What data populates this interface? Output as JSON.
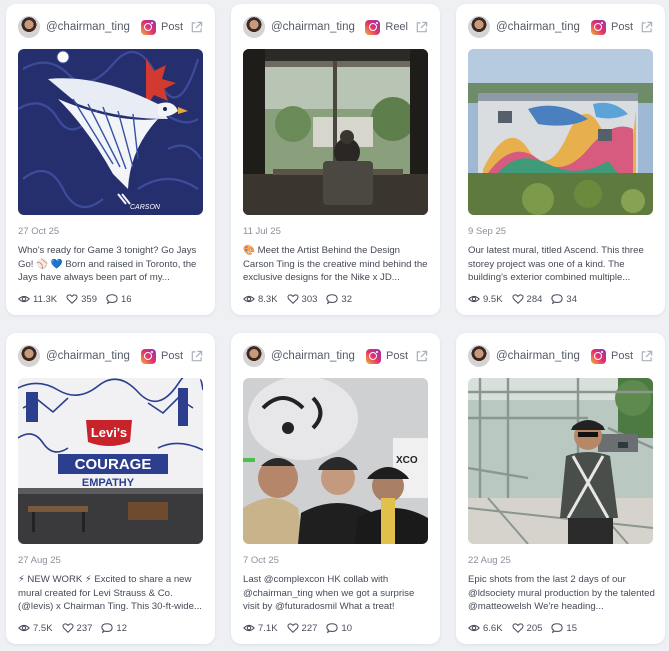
{
  "cards": [
    {
      "handle": "@chairman_ting",
      "post_type": "Post",
      "date": "27 Oct 25",
      "caption": "Who's ready for Game 3 tonight? Go Jays Go! ⚾ 💙 Born and raised in Toronto, the Jays have always been part of my...",
      "views": "11.3K",
      "likes": "359",
      "comments": "16"
    },
    {
      "handle": "@chairman_ting",
      "post_type": "Reel",
      "date": "11 Jul 25",
      "caption": "🎨 Meet the Artist Behind the Design Carson Ting is the creative mind behind the exclusive designs for the Nike x JD...",
      "views": "8.3K",
      "likes": "303",
      "comments": "32"
    },
    {
      "handle": "@chairman_ting",
      "post_type": "Post",
      "date": "9 Sep 25",
      "caption": "Our latest mural, titled Ascend. This three storey project was one of a kind. The building's exterior combined multiple...",
      "views": "9.5K",
      "likes": "284",
      "comments": "34"
    },
    {
      "handle": "@chairman_ting",
      "post_type": "Post",
      "date": "27 Aug 25",
      "caption": "⚡ NEW WORK ⚡ Excited to share a new mural created for Levi Strauss & Co. (@levis) x Chairman Ting. This 30-ft-wide...",
      "views": "7.5K",
      "likes": "237",
      "comments": "12"
    },
    {
      "handle": "@chairman_ting",
      "post_type": "Post",
      "date": "7 Oct 25",
      "caption": "Last @complexcon HK collab with @chairman_ting when we got a surprise visit by @futuradosmil What a treat!",
      "views": "7.1K",
      "likes": "227",
      "comments": "10"
    },
    {
      "handle": "@chairman_ting",
      "post_type": "Post",
      "date": "22 Aug 25",
      "caption": "Epic shots from the last 2 days of our @ldsociety mural production by the talented @matteowelsh We're heading...",
      "views": "6.6K",
      "likes": "205",
      "comments": "15"
    }
  ],
  "images": {
    "levis_logo": "Levi's",
    "courage_text": "COURAGE",
    "empathy_text": "EMPATHY",
    "xco_text": "XCO"
  },
  "icons": {
    "platform": "instagram-icon",
    "external": "external-link-icon",
    "views": "eye-icon",
    "likes": "heart-icon",
    "comments": "comment-bubble-icon"
  },
  "colors": {
    "page_bg": "#eef0f4",
    "card_bg": "#ffffff",
    "meta_text": "#8b909c",
    "body_text": "#454a57"
  }
}
